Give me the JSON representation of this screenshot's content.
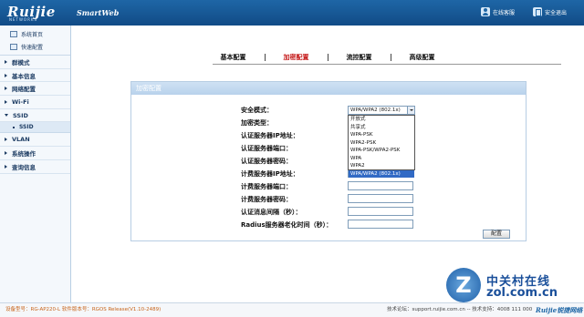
{
  "header": {
    "logo": "Ruijie",
    "logo_sub": "NETWORKS",
    "app_name": "SmartWeb",
    "online_help": "在线客服",
    "safe_exit": "安全退出"
  },
  "sidebar": {
    "top_links": [
      {
        "label": "系统首页",
        "icon": "home-icon"
      },
      {
        "label": "快速配置",
        "icon": "quick-config-icon"
      }
    ],
    "items": [
      {
        "label": "群模式",
        "open": false
      },
      {
        "label": "基本信息",
        "open": false
      },
      {
        "label": "网络配置",
        "open": false
      },
      {
        "label": "Wi-Fi",
        "open": false
      },
      {
        "label": "SSID",
        "open": true
      }
    ],
    "sub_item": "SSID",
    "items_after": [
      {
        "label": "VLAN",
        "open": false
      },
      {
        "label": "系统操作",
        "open": false
      },
      {
        "label": "查询信息",
        "open": false
      }
    ]
  },
  "tabs": [
    {
      "label": "基本配置",
      "active": false
    },
    {
      "label": "加密配置",
      "active": true
    },
    {
      "label": "流控配置",
      "active": false
    },
    {
      "label": "高级配置",
      "active": false
    }
  ],
  "panel": {
    "title": "加密配置",
    "security_mode_label": "安全模式：",
    "selected_mode": "WPA/WPA2 (802.1x)",
    "mode_options": [
      "开放式",
      "共享式",
      "WPA-PSK",
      "WPA2-PSK",
      "WPA-PSK/WPA2-PSK",
      "WPA",
      "WPA2",
      "WPA/WPA2 (802.1x)"
    ],
    "fields": [
      {
        "label": "加密类型："
      },
      {
        "label": "认证服务器IP地址："
      },
      {
        "label": "认证服务器端口："
      },
      {
        "label": "认证服务器密码："
      },
      {
        "label": "计费服务器IP地址："
      },
      {
        "label": "计费服务器端口："
      },
      {
        "label": "计费服务器密码："
      },
      {
        "label": "认证消息间隔（秒）："
      },
      {
        "label": "Radius服务器老化时间（秒）："
      }
    ],
    "submit_label": "配置"
  },
  "footer": {
    "device_info": "设备型号：RG-AP220-L   软件版本号：RGOS Release(V1.10-2489)",
    "support": "技术论坛：support.ruijie.com.cn  -- 技术支持：4008 111 000",
    "logo": "Ruijie锐捷网络"
  },
  "watermark": {
    "letter": "Z",
    "cn": "中关村在线",
    "en": "zol.com.cn"
  }
}
